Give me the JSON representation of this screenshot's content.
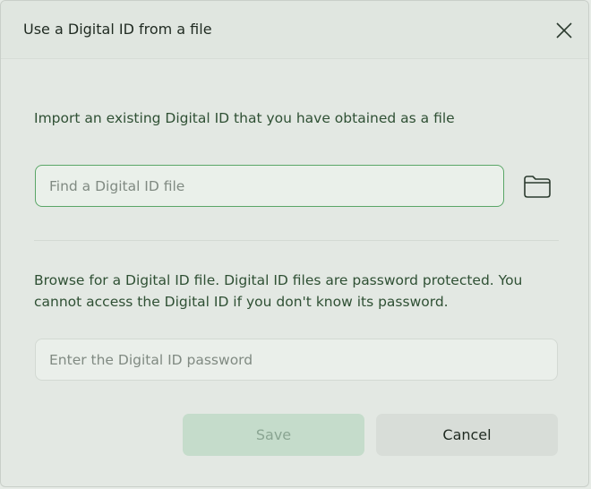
{
  "dialog": {
    "title": "Use a Digital ID from a file",
    "close_icon": "close-icon",
    "import_text": "Import an existing Digital ID that you have obtained as a file",
    "file_input": {
      "placeholder": "Find a Digital ID file",
      "value": ""
    },
    "browse_icon": "folder-icon",
    "browse_text": "Browse for a Digital ID file. Digital ID files are password protected. You cannot access the Digital ID if you don't know its password.",
    "password_input": {
      "placeholder": "Enter the Digital ID password",
      "value": ""
    },
    "save_label": "Save",
    "cancel_label": "Cancel"
  },
  "colors": {
    "accent": "#5aa667",
    "save_disabled_bg": "#c5dccb",
    "save_disabled_text": "#8aa592",
    "body_text": "#2f5034"
  }
}
